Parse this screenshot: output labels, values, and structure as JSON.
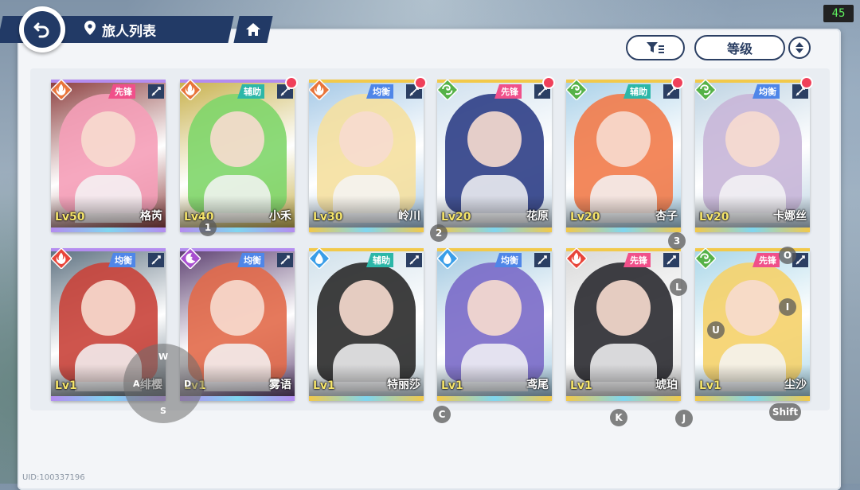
{
  "header": {
    "title": "旅人列表"
  },
  "fps": "45",
  "sort": {
    "label": "等级"
  },
  "uid": "UID:100337196",
  "cards": [
    {
      "name": "格芮",
      "level": "Lv50",
      "role": "先锋",
      "role_color": "#f0508a",
      "element": "fire",
      "element_color": "#e8743a",
      "frame": "#b48cf0",
      "hair": "#f59fb8",
      "bg": "#8a3b3b",
      "red_dot": false
    },
    {
      "name": "小禾",
      "level": "Lv40",
      "role": "辅助",
      "role_color": "#2cb7a8",
      "element": "fire",
      "element_color": "#e8743a",
      "frame": "#b48cf0",
      "hair": "#7fd66a",
      "bg": "#c7b04a",
      "red_dot": true
    },
    {
      "name": "岭川",
      "level": "Lv30",
      "role": "均衡",
      "role_color": "#4f86e8",
      "element": "fire",
      "element_color": "#e8743a",
      "frame": "#f2c94a",
      "hair": "#f5e0a0",
      "bg": "#a4c8e6",
      "red_dot": true
    },
    {
      "name": "花原",
      "level": "Lv20",
      "role": "先锋",
      "role_color": "#f0508a",
      "element": "wind",
      "element_color": "#56b248",
      "frame": "#f2c94a",
      "hair": "#2d3e86",
      "bg": "#cfe0ee",
      "red_dot": true
    },
    {
      "name": "杏子",
      "level": "Lv20",
      "role": "辅助",
      "role_color": "#2cb7a8",
      "element": "wind",
      "element_color": "#56b248",
      "frame": "#f2c94a",
      "hair": "#f27b4a",
      "bg": "#a8d0e8",
      "red_dot": true
    },
    {
      "name": "卡娜丝",
      "level": "Lv20",
      "role": "均衡",
      "role_color": "#4f86e8",
      "element": "wind",
      "element_color": "#56b248",
      "frame": "#f2c94a",
      "hair": "#c8b6d8",
      "bg": "#bcd2e2",
      "red_dot": true
    },
    {
      "name": "绯樱",
      "level": "Lv1",
      "role": "均衡",
      "role_color": "#4f86e8",
      "element": "fire",
      "element_color": "#e8453a",
      "frame": "#b48cf0",
      "hair": "#c9423a",
      "bg": "#5a6e7e",
      "red_dot": false
    },
    {
      "name": "雾语",
      "level": "Lv1",
      "role": "均衡",
      "role_color": "#4f86e8",
      "element": "dark",
      "element_color": "#a84fd0",
      "frame": "#b48cf0",
      "hair": "#e26a4a",
      "bg": "#5a3d6e",
      "red_dot": false
    },
    {
      "name": "特丽莎",
      "level": "Lv1",
      "role": "辅助",
      "role_color": "#2cb7a8",
      "element": "water",
      "element_color": "#3a9ee8",
      "frame": "#f2c94a",
      "hair": "#2a2a2a",
      "bg": "#cfe0ea",
      "red_dot": false
    },
    {
      "name": "鸢尾",
      "level": "Lv1",
      "role": "均衡",
      "role_color": "#4f86e8",
      "element": "water",
      "element_color": "#3a9ee8",
      "frame": "#f2c94a",
      "hair": "#7a6ac8",
      "bg": "#9fc7e0",
      "red_dot": false
    },
    {
      "name": "琥珀",
      "level": "Lv1",
      "role": "先锋",
      "role_color": "#f0508a",
      "element": "fire",
      "element_color": "#e8453a",
      "frame": "#f2c94a",
      "hair": "#2a2a30",
      "bg": "#d8d8d8",
      "red_dot": false
    },
    {
      "name": "尘沙",
      "level": "Lv1",
      "role": "先锋",
      "role_color": "#f0508a",
      "element": "wind",
      "element_color": "#56b248",
      "frame": "#f2c94a",
      "hair": "#f5d26a",
      "bg": "#a8d6e8",
      "red_dot": false
    }
  ],
  "key_hints": {
    "k1": "1",
    "k2": "2",
    "k3": "3",
    "kO": "O",
    "kL": "L",
    "kI": "I",
    "kU": "U",
    "kC": "C",
    "kK": "K",
    "kJ": "J",
    "kShift": "Shift",
    "kW": "W",
    "kA": "A",
    "kS": "S",
    "kD": "D"
  }
}
